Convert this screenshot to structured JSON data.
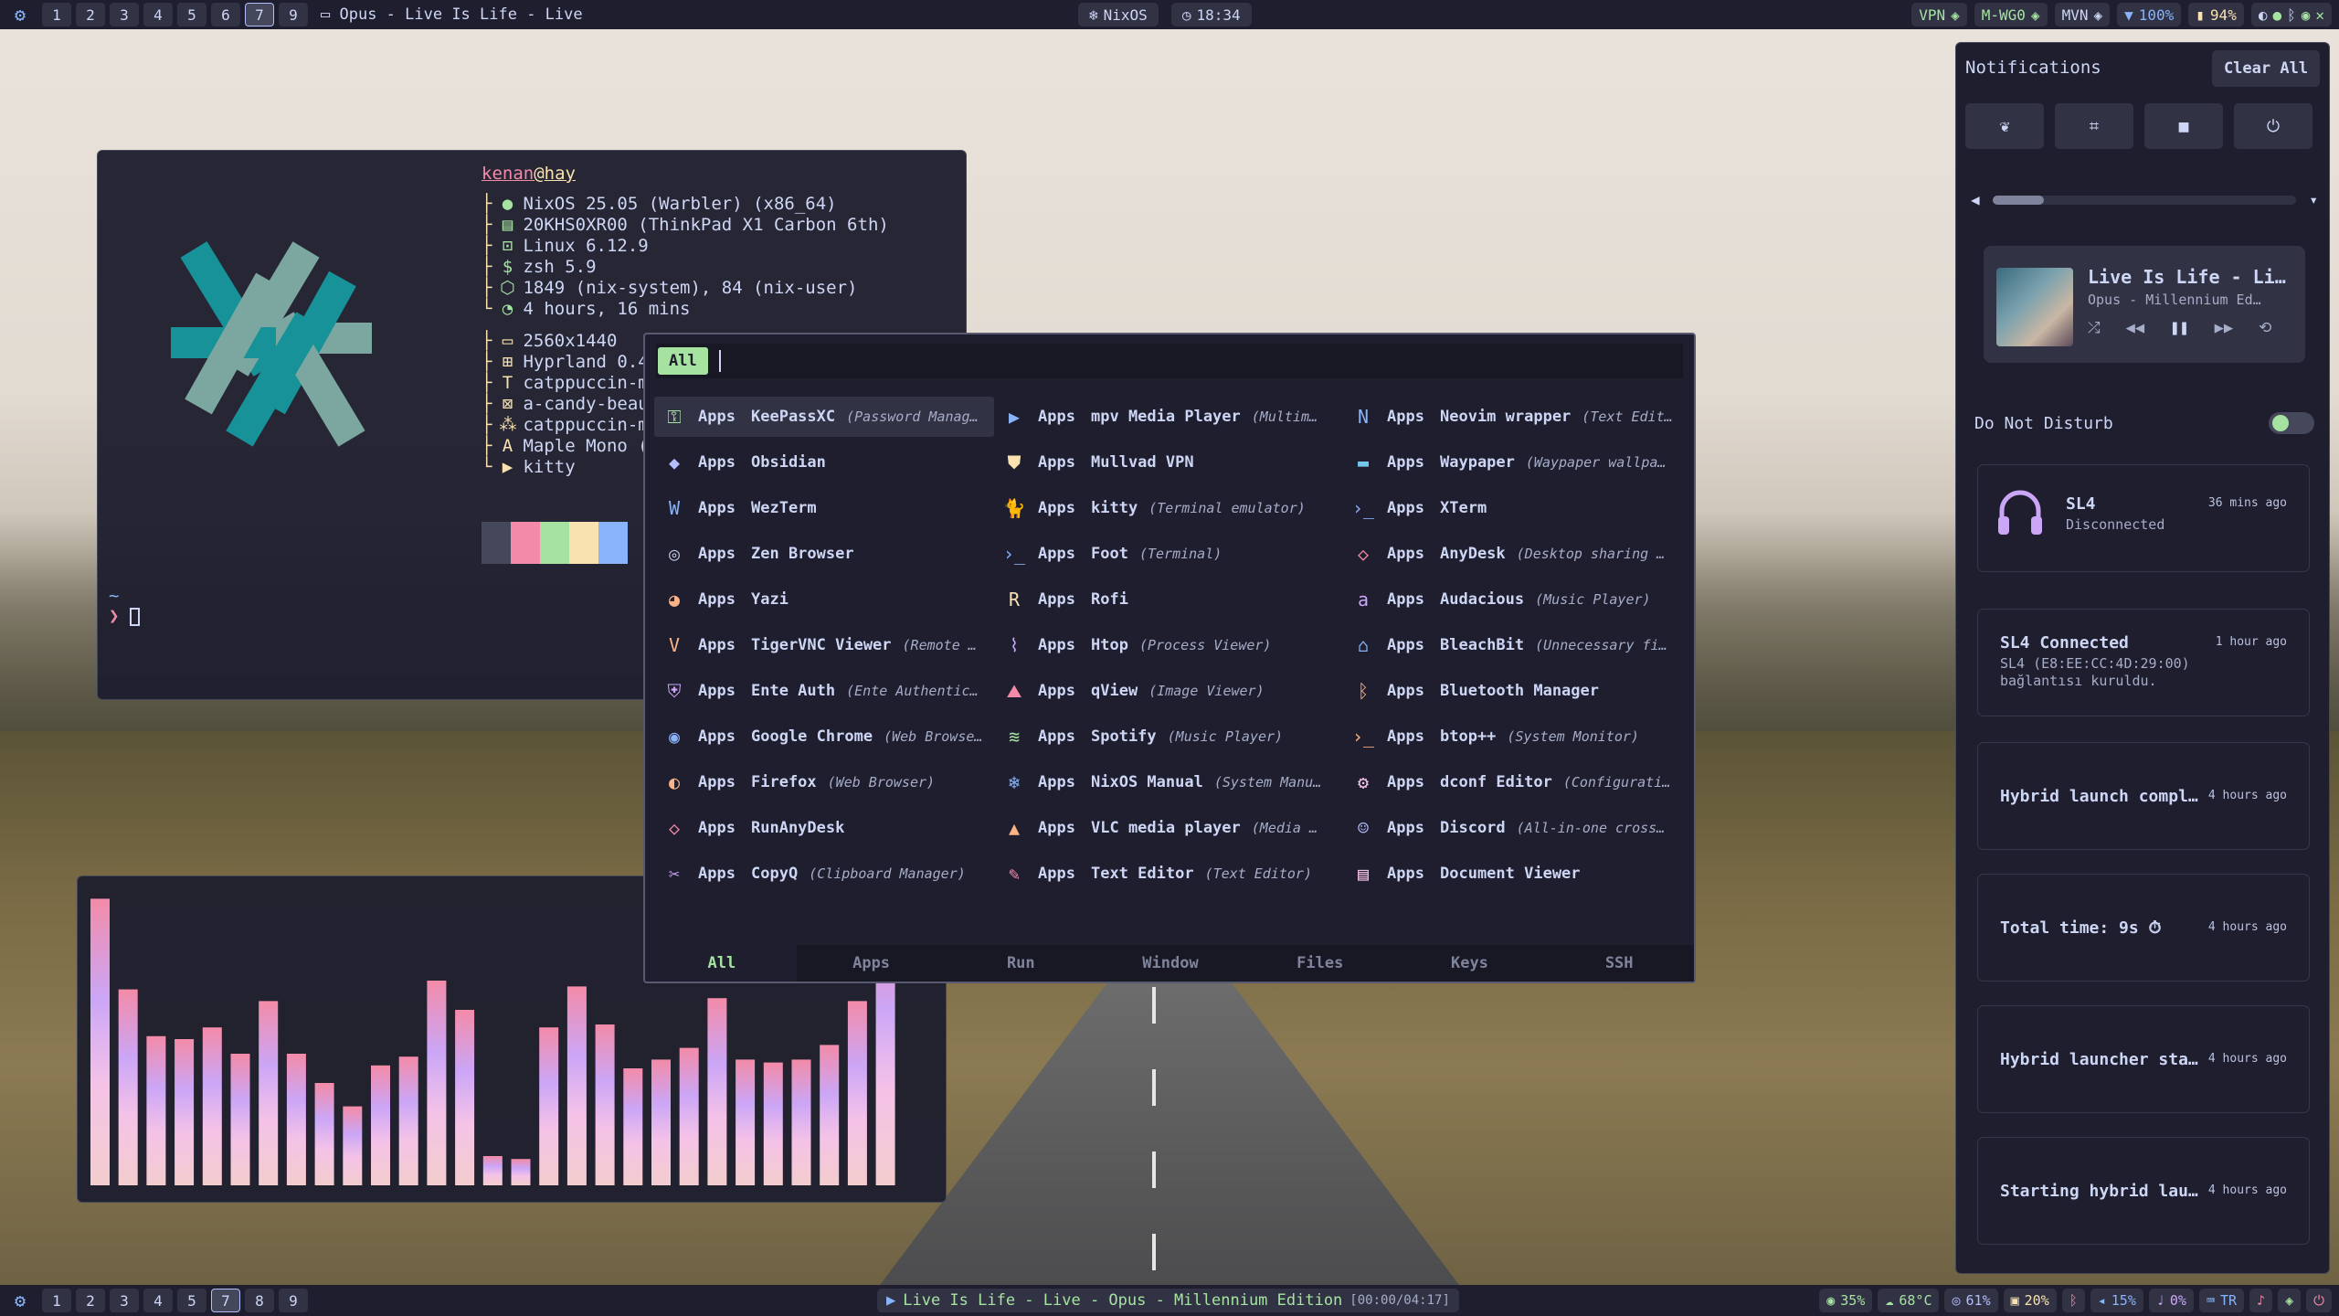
{
  "topbar": {
    "workspaces": [
      "1",
      "2",
      "3",
      "4",
      "5",
      "6",
      "7",
      "9"
    ],
    "active_workspace": "7",
    "window_title": "Opus - Live Is Life - Live",
    "os_label": "NixOS",
    "clock": "18:34",
    "right": {
      "vpn": "VPN",
      "wg": "M-WG0",
      "mvn": "MVN",
      "wifi": "100%",
      "battery": "94%"
    }
  },
  "bottombar": {
    "workspaces": [
      "1",
      "2",
      "3",
      "4",
      "5",
      "7",
      "8",
      "9"
    ],
    "active_workspace": "7",
    "now_playing": "Live Is Life - Live - Opus - Millennium Edition",
    "now_playing_time": "[00:00/04:17]",
    "stats": {
      "cpu": "35%",
      "temp": "68°C",
      "ram": "61%",
      "disk": "20%",
      "brightness": "15%",
      "volume": "0%",
      "layout": "TR"
    }
  },
  "terminal": {
    "user": "kenan",
    "host": "hay",
    "info": [
      "NixOS 25.05 (Warbler) (x86_64)",
      "20KHS0XR00 (ThinkPad X1 Carbon 6th)",
      "Linux 6.12.9",
      "zsh 5.9",
      "1849 (nix-system), 84 (nix-user)",
      "4 hours, 16 mins"
    ],
    "info2": [
      "2560x1440",
      "Hyprland 0.4",
      "catppuccin-m",
      "a-candy-beau",
      "catppuccin-m",
      "Maple Mono (",
      "kitty"
    ],
    "prompt_dir": "~",
    "swatch_colors": [
      "#45475a",
      "#f38ba8",
      "#a6e3a1",
      "#f9e2af",
      "#89b4fa"
    ]
  },
  "visualizer": {
    "levels": [
      0.98,
      0.67,
      0.51,
      0.5,
      0.54,
      0.45,
      0.63,
      0.45,
      0.35,
      0.27,
      0.41,
      0.44,
      0.7,
      0.6,
      0.1,
      0.09,
      0.54,
      0.68,
      0.55,
      0.4,
      0.43,
      0.47,
      0.64,
      0.43,
      0.42,
      0.43,
      0.48,
      0.63,
      0.93
    ]
  },
  "launcher": {
    "mode_tag": "All",
    "search_value": "",
    "items": [
      {
        "cat": "Apps",
        "name": "KeePassXC",
        "desc": "(Password Manag…",
        "icon": "key-icon",
        "color": "#a6e3a1"
      },
      {
        "cat": "Apps",
        "name": "mpv Media Player",
        "desc": "(Multim…",
        "icon": "play-icon",
        "color": "#89b4fa"
      },
      {
        "cat": "Apps",
        "name": "Neovim wrapper",
        "desc": "(Text Edit…",
        "icon": "neovim-icon",
        "color": "#89b4fa"
      },
      {
        "cat": "Apps",
        "name": "Obsidian",
        "desc": "",
        "icon": "obsidian-icon",
        "color": "#b4befe"
      },
      {
        "cat": "Apps",
        "name": "Mullvad VPN",
        "desc": "",
        "icon": "mullvad-icon",
        "color": "#f9e2af"
      },
      {
        "cat": "Apps",
        "name": "Waypaper",
        "desc": "(Waypaper wallpa…",
        "icon": "wallpaper-icon",
        "color": "#74c7ec"
      },
      {
        "cat": "Apps",
        "name": "WezTerm",
        "desc": "",
        "icon": "wezterm-icon",
        "color": "#89b4fa"
      },
      {
        "cat": "Apps",
        "name": "kitty",
        "desc": "(Terminal emulator)",
        "icon": "kitty-icon",
        "color": "#fab387"
      },
      {
        "cat": "Apps",
        "name": "XTerm",
        "desc": "",
        "icon": "terminal-icon",
        "color": "#89b4fa"
      },
      {
        "cat": "Apps",
        "name": "Zen Browser",
        "desc": "",
        "icon": "zen-icon",
        "color": "#bac2de"
      },
      {
        "cat": "Apps",
        "name": "Foot",
        "desc": "(Terminal)",
        "icon": "terminal-icon",
        "color": "#89b4fa"
      },
      {
        "cat": "Apps",
        "name": "AnyDesk",
        "desc": "(Desktop sharing …",
        "icon": "anydesk-icon",
        "color": "#f38ba8"
      },
      {
        "cat": "Apps",
        "name": "Yazi",
        "desc": "",
        "icon": "yazi-icon",
        "color": "#fab387"
      },
      {
        "cat": "Apps",
        "name": "Rofi",
        "desc": "",
        "icon": "rofi-icon",
        "color": "#f9e2af"
      },
      {
        "cat": "Apps",
        "name": "Audacious",
        "desc": "(Music Player)",
        "icon": "audacious-icon",
        "color": "#cba6f7"
      },
      {
        "cat": "Apps",
        "name": "TigerVNC Viewer",
        "desc": "(Remote …",
        "icon": "vnc-icon",
        "color": "#fab387"
      },
      {
        "cat": "Apps",
        "name": "Htop",
        "desc": "(Process Viewer)",
        "icon": "chart-icon",
        "color": "#cba6f7"
      },
      {
        "cat": "Apps",
        "name": "BleachBit",
        "desc": "(Unnecessary fi…",
        "icon": "broom-icon",
        "color": "#89b4fa"
      },
      {
        "cat": "Apps",
        "name": "Ente Auth",
        "desc": "(Ente Authentic…",
        "icon": "shield-icon",
        "color": "#cba6f7"
      },
      {
        "cat": "Apps",
        "name": "qView",
        "desc": "(Image Viewer)",
        "icon": "image-icon",
        "color": "#f38ba8"
      },
      {
        "cat": "Apps",
        "name": "Bluetooth Manager",
        "desc": "",
        "icon": "bluetooth-icon",
        "color": "#fab387"
      },
      {
        "cat": "Apps",
        "name": "Google Chrome",
        "desc": "(Web Browse…",
        "icon": "chrome-icon",
        "color": "#89b4fa"
      },
      {
        "cat": "Apps",
        "name": "Spotify",
        "desc": "(Music Player)",
        "icon": "spotify-icon",
        "color": "#a6e3a1"
      },
      {
        "cat": "Apps",
        "name": "btop++",
        "desc": "(System Monitor)",
        "icon": "terminal-icon",
        "color": "#fab387"
      },
      {
        "cat": "Apps",
        "name": "Firefox",
        "desc": "(Web Browser)",
        "icon": "firefox-icon",
        "color": "#fab387"
      },
      {
        "cat": "Apps",
        "name": "NixOS Manual",
        "desc": "(System Manu…",
        "icon": "nixos-icon",
        "color": "#89b4fa"
      },
      {
        "cat": "Apps",
        "name": "dconf Editor",
        "desc": "(Configurati…",
        "icon": "dconf-icon",
        "color": "#f5c2e7"
      },
      {
        "cat": "Apps",
        "name": "RunAnyDesk",
        "desc": "",
        "icon": "anydesk-icon",
        "color": "#f38ba8"
      },
      {
        "cat": "Apps",
        "name": "VLC media player",
        "desc": "(Media …",
        "icon": "vlc-icon",
        "color": "#fab387"
      },
      {
        "cat": "Apps",
        "name": "Discord",
        "desc": "(All-in-one cross…",
        "icon": "discord-icon",
        "color": "#b4befe"
      },
      {
        "cat": "Apps",
        "name": "CopyQ",
        "desc": "(Clipboard Manager)",
        "icon": "scissors-icon",
        "color": "#cba6f7"
      },
      {
        "cat": "Apps",
        "name": "Text Editor",
        "desc": "(Text Editor)",
        "icon": "edit-icon",
        "color": "#f38ba8"
      },
      {
        "cat": "Apps",
        "name": "Document Viewer",
        "desc": "",
        "icon": "document-icon",
        "color": "#f5c2e7"
      }
    ],
    "tabs": [
      "All",
      "Apps",
      "Run",
      "Window",
      "Files",
      "Keys",
      "SSH"
    ],
    "active_tab": "All"
  },
  "notifications": {
    "title": "Notifications",
    "clear_label": "Clear All",
    "volume_level": 0.17,
    "player": {
      "title": "Live Is Life - Li…",
      "artist": "Opus - Millennium Ed…"
    },
    "dnd_label": "Do Not Disturb",
    "items": [
      {
        "title": "SL4",
        "time": "36 mins ago",
        "body": "Disconnected",
        "has_icon": true
      },
      {
        "title": "SL4 Connected",
        "time": "1 hour ago",
        "body": "SL4 (E8:EE:CC:4D:29:00)\nbağlantısı kuruldu.",
        "has_icon": false
      },
      {
        "title": "Hybrid launch compl…",
        "time": "4 hours ago",
        "body": "",
        "has_icon": false
      },
      {
        "title": "Total time: 9s ⏱",
        "time": "4 hours ago",
        "body": "",
        "has_icon": false
      },
      {
        "title": "Hybrid launcher sta…",
        "time": "4 hours ago",
        "body": "",
        "has_icon": false
      },
      {
        "title": "Starting hybrid lau…",
        "time": "4 hours ago",
        "body": "",
        "has_icon": false
      }
    ]
  }
}
